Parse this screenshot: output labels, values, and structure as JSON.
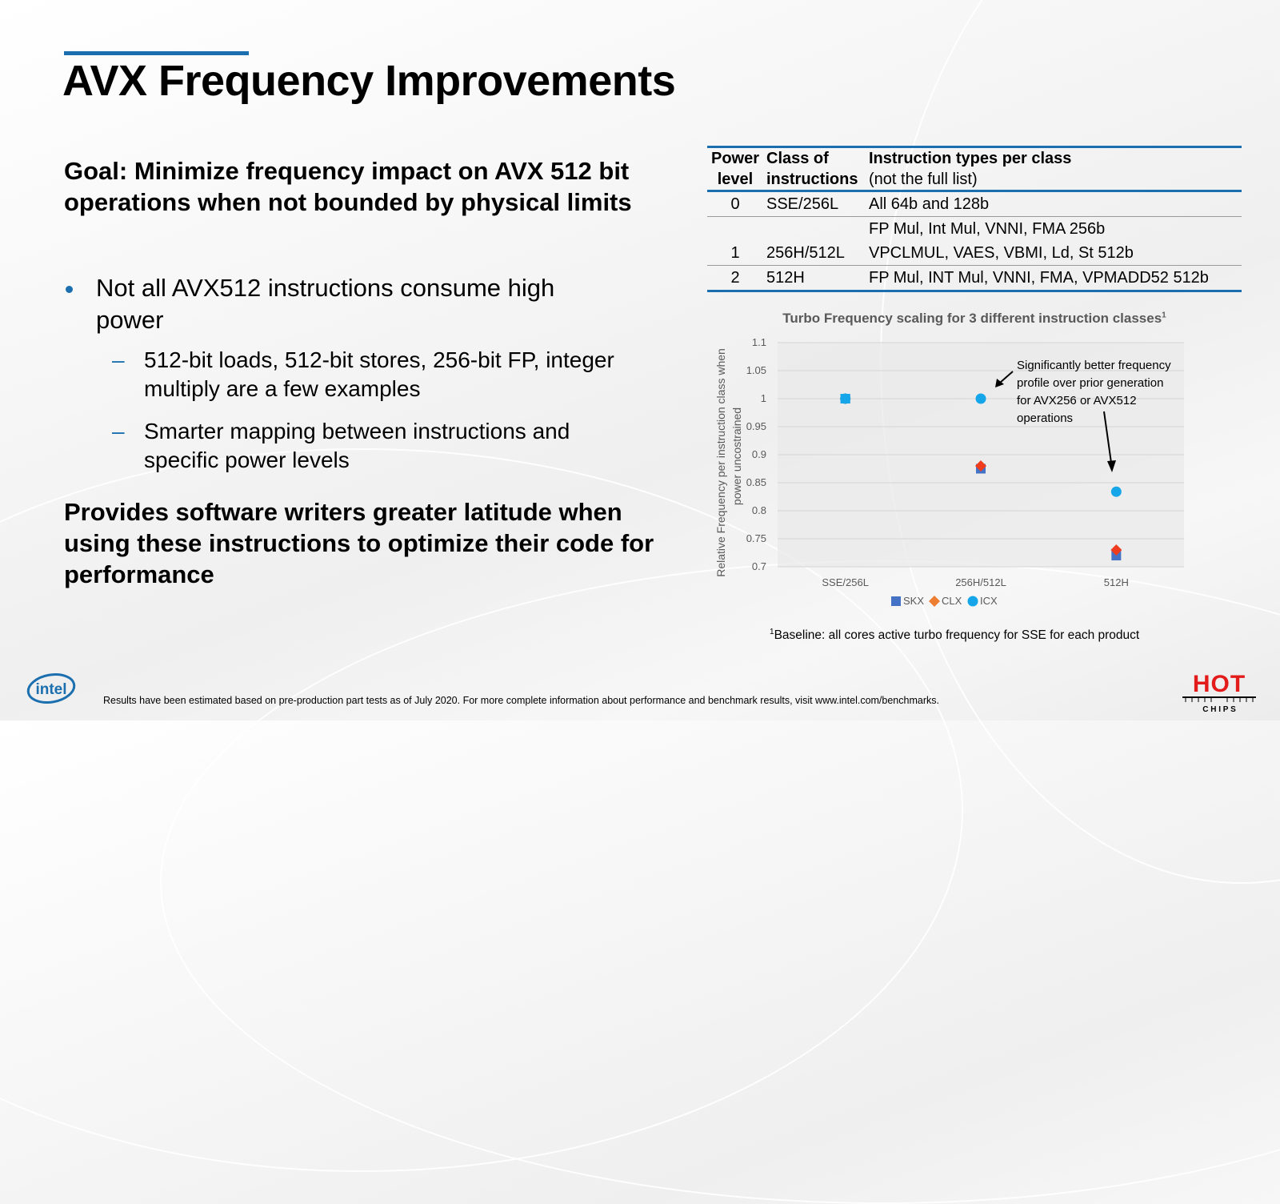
{
  "slide": {
    "title": "AVX Frequency Improvements",
    "goal": "Goal:  Minimize frequency impact on AVX 512 bit operations when not bounded by physical limits",
    "bullet": "Not all AVX512 instructions consume high power",
    "sub_bullets": [
      "512-bit loads, 512-bit stores, 256-bit FP, integer multiply are a few examples",
      "Smarter mapping between instructions and specific power levels"
    ],
    "provides": "Provides software writers greater latitude when using these instructions to optimize their code for performance",
    "accent_color": "#1b6fae"
  },
  "power_table": {
    "headers": {
      "col0_line1": "Power",
      "col0_line2": "level",
      "col1_line1": "Class of",
      "col1_line2": "instructions",
      "col2_line1": "Instruction types per class",
      "col2_line2": "(not the full list)"
    },
    "rows": [
      {
        "level": "0",
        "class": "SSE/256L",
        "types_line1": "All 64b and 128b",
        "types_line2": ""
      },
      {
        "level": "1",
        "class": "256H/512L",
        "types_line1": "FP Mul, Int Mul, VNNI, FMA 256b",
        "types_line2": "VPCLMUL, VAES, VBMI, Ld, St 512b"
      },
      {
        "level": "2",
        "class": "512H",
        "types_line1": "FP Mul, INT Mul, VNNI, FMA, VPMADD52 512b",
        "types_line2": ""
      }
    ]
  },
  "chart_data": {
    "type": "scatter",
    "title": "Turbo Frequency scaling for 3 different instruction classes",
    "title_superscript": "1",
    "xlabel": "",
    "ylabel": "Relative Frequency per instruction class when power uncostrained",
    "ylabel_lines": [
      "Relative Frequency per instruction class when",
      "power uncostrained"
    ],
    "categories": [
      "SSE/256L",
      "256H/512L",
      "512H"
    ],
    "ylim": [
      0.7,
      1.1
    ],
    "yticks": [
      0.7,
      0.75,
      0.8,
      0.85,
      0.9,
      0.95,
      1,
      1.05,
      1.1
    ],
    "ytick_labels": [
      "0.7",
      "0.75",
      "0.8",
      "0.85",
      "0.9",
      "0.95",
      "1",
      "1.05",
      "1.1"
    ],
    "grid": true,
    "legend_position": "bottom",
    "series": [
      {
        "name": "SKX",
        "marker": "square",
        "color": "#4472c4",
        "values": [
          1.0,
          0.875,
          0.72
        ]
      },
      {
        "name": "CLX",
        "marker": "diamond",
        "color": "#ed7d31",
        "values": [
          1.0,
          0.88,
          0.73
        ]
      },
      {
        "name": "ICX",
        "marker": "circle",
        "color": "#14a6e8",
        "values": [
          1.0,
          1.0,
          0.834
        ]
      }
    ],
    "annotation": {
      "lines": [
        "Significantly better frequency",
        "profile over prior generation",
        "for AVX256 or AVX512",
        "operations"
      ],
      "points_to": [
        "ICX 256H/512L",
        "ICX 512H"
      ]
    },
    "footnote": "Baseline: all cores active turbo frequency for SSE for each product",
    "footnote_superscript": "1"
  },
  "footer": {
    "disclaimer": "Results have been estimated based on pre-production part tests as of July 2020. For more complete information about performance and benchmark results, visit www.intel.com/benchmarks.",
    "intel_logo_text": "intel",
    "hotchips_top": "HOT",
    "hotchips_bottom": "C H I P S"
  }
}
